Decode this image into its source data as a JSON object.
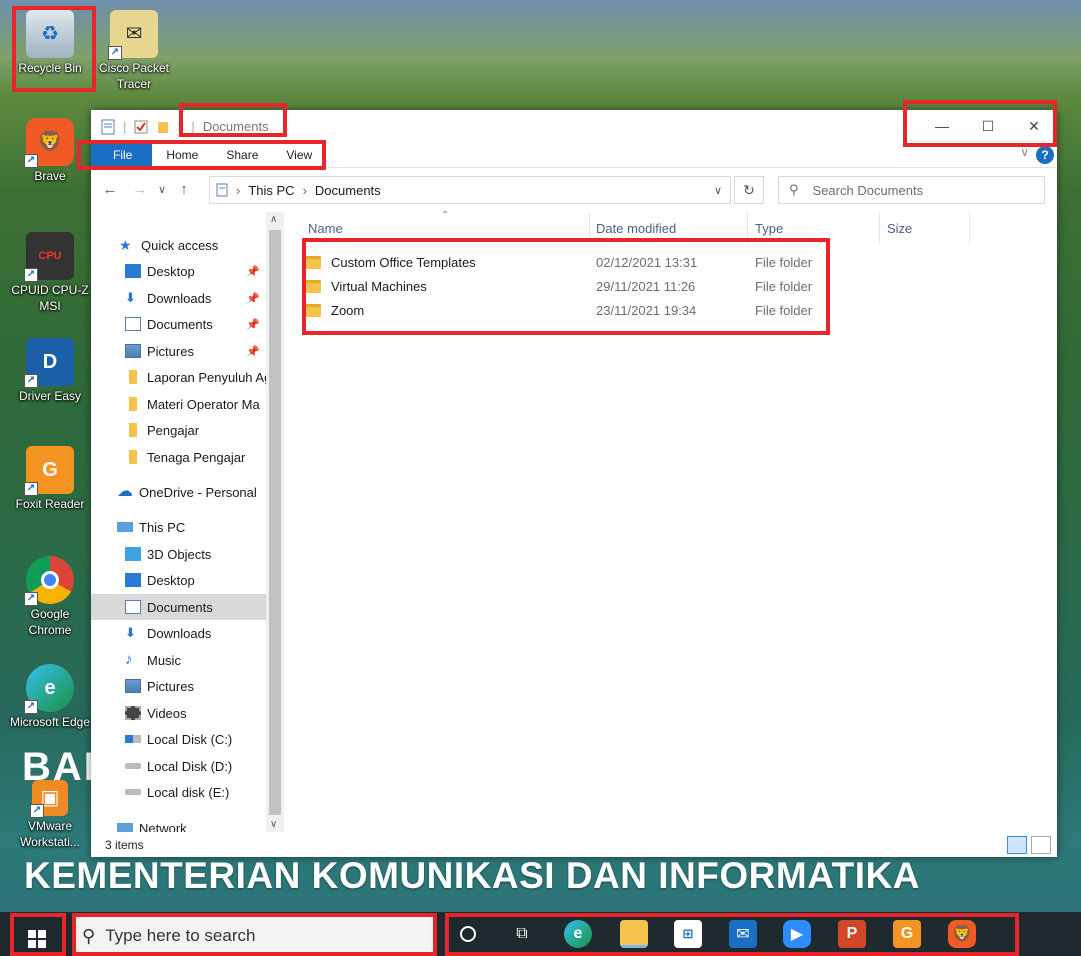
{
  "desktop": {
    "icons": [
      {
        "label": "Recycle Bin"
      },
      {
        "label": "Cisco Packet Tracer"
      },
      {
        "label": "Brave"
      },
      {
        "label": "CPUID CPU-Z MSI"
      },
      {
        "label": "Driver Easy"
      },
      {
        "label": "Foxit Reader"
      },
      {
        "label": "Google Chrome"
      },
      {
        "label": "Microsoft Edge"
      },
      {
        "label": "VMware Workstati..."
      }
    ],
    "banner_small": "BAL",
    "banner": "KEMENTERIAN KOMUNIKASI DAN INFORMATIKA"
  },
  "window": {
    "title": "Documents",
    "controls": {
      "minimize": "—",
      "maximize": "☐",
      "close": "✕"
    },
    "ribbon_tabs": [
      "File",
      "Home",
      "Share",
      "View"
    ],
    "help": "?",
    "address": {
      "root": "This PC",
      "current": "Documents"
    },
    "search_placeholder": "Search Documents",
    "nav": {
      "quick_access": "Quick access",
      "quick_items": [
        "Desktop",
        "Downloads",
        "Documents",
        "Pictures",
        "Laporan Penyuluh Ag",
        "Materi Operator Ma",
        "Pengajar",
        "Tenaga Pengajar"
      ],
      "onedrive": "OneDrive - Personal",
      "this_pc": "This PC",
      "pc_items": [
        "3D Objects",
        "Desktop",
        "Documents",
        "Downloads",
        "Music",
        "Pictures",
        "Videos",
        "Local Disk (C:)",
        "Local Disk (D:)",
        "Local disk (E:)"
      ],
      "network": "Network",
      "selected": "Documents"
    },
    "columns": {
      "name": "Name",
      "date": "Date modified",
      "type": "Type",
      "size": "Size"
    },
    "files": [
      {
        "name": "Custom Office Templates",
        "date": "02/12/2021 13:31",
        "type": "File folder"
      },
      {
        "name": "Virtual Machines",
        "date": "29/11/2021 11:26",
        "type": "File folder"
      },
      {
        "name": "Zoom",
        "date": "23/11/2021 19:34",
        "type": "File folder"
      }
    ],
    "status": "3 items"
  },
  "taskbar": {
    "search_placeholder": "Type here to search",
    "apps": [
      "cortana",
      "task-view",
      "edge",
      "file-explorer",
      "microsoft-store",
      "mail",
      "zoom",
      "powerpoint",
      "foxit-reader",
      "brave"
    ]
  },
  "colors": {
    "accent": "#1a6ec4",
    "highlight": "#e8262a",
    "taskbar": "#1e2a2e"
  }
}
